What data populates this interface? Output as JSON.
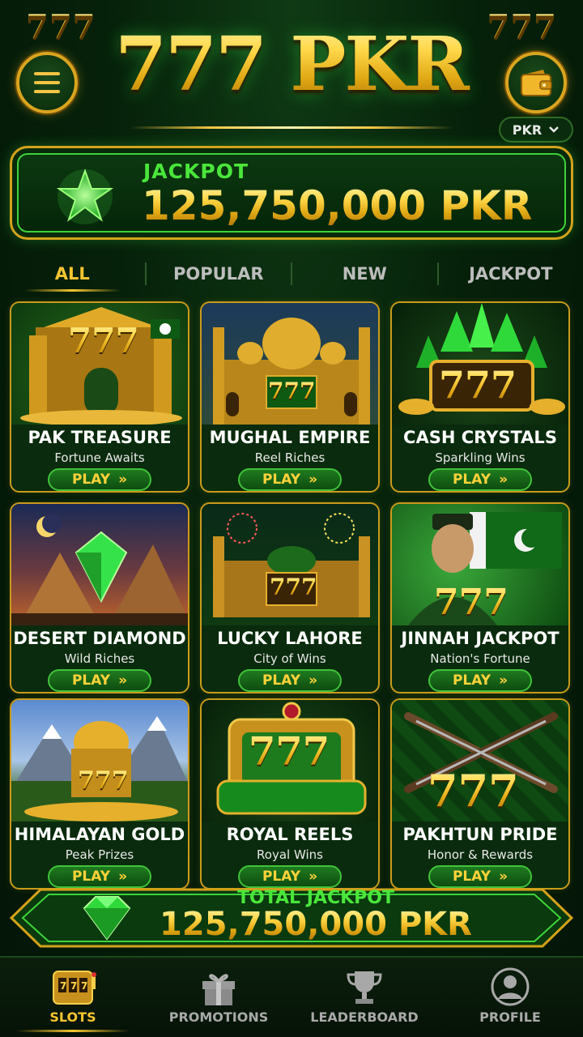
{
  "header": {
    "corner_left": "777",
    "corner_right": "777",
    "title": "777 PKR",
    "menu_icon": "hamburger-menu-icon",
    "wallet_icon": "wallet-icon",
    "currency": "PKR"
  },
  "jackpot": {
    "label": "JACKPOT",
    "amount": "125,750,000 PKR",
    "icon": "star-icon"
  },
  "tabs": [
    {
      "label": "ALL",
      "active": true
    },
    {
      "label": "POPULAR",
      "active": false
    },
    {
      "label": "NEW",
      "active": false
    },
    {
      "label": "JACKPOT",
      "active": false
    }
  ],
  "games": [
    {
      "title": "PAK TREASURE",
      "subtitle": "Fortune Awaits",
      "play": "PLAY"
    },
    {
      "title": "MUGHAL EMPIRE",
      "subtitle": "Reel Riches",
      "play": "PLAY"
    },
    {
      "title": "CASH CRYSTALS",
      "subtitle": "Sparkling Wins",
      "play": "PLAY"
    },
    {
      "title": "DESERT DIAMOND",
      "subtitle": "Wild Riches",
      "play": "PLAY"
    },
    {
      "title": "LUCKY LAHORE",
      "subtitle": "City of Wins",
      "play": "PLAY"
    },
    {
      "title": "JINNAH JACKPOT",
      "subtitle": "Nation's Fortune",
      "play": "PLAY"
    },
    {
      "title": "HIMALAYAN GOLD",
      "subtitle": "Peak Prizes",
      "play": "PLAY"
    },
    {
      "title": "ROYAL REELS",
      "subtitle": "Royal Wins",
      "play": "PLAY"
    },
    {
      "title": "PAKHTUN PRIDE",
      "subtitle": "Honor & Rewards",
      "play": "PLAY"
    }
  ],
  "art_text": "777",
  "total_jackpot": {
    "label": "TOTAL JACKPOT",
    "amount": "125,750,000 PKR",
    "icon": "emerald-gem-icon"
  },
  "nav": [
    {
      "label": "SLOTS",
      "icon": "slot-machine-icon",
      "active": true
    },
    {
      "label": "PROMOTIONS",
      "icon": "gift-icon",
      "active": false
    },
    {
      "label": "LEADERBOARD",
      "icon": "trophy-icon",
      "active": false
    },
    {
      "label": "PROFILE",
      "icon": "user-profile-icon",
      "active": false
    }
  ],
  "colors": {
    "gold": "#f6c530",
    "green_accent": "#4ae63b",
    "background": "#06210a"
  }
}
